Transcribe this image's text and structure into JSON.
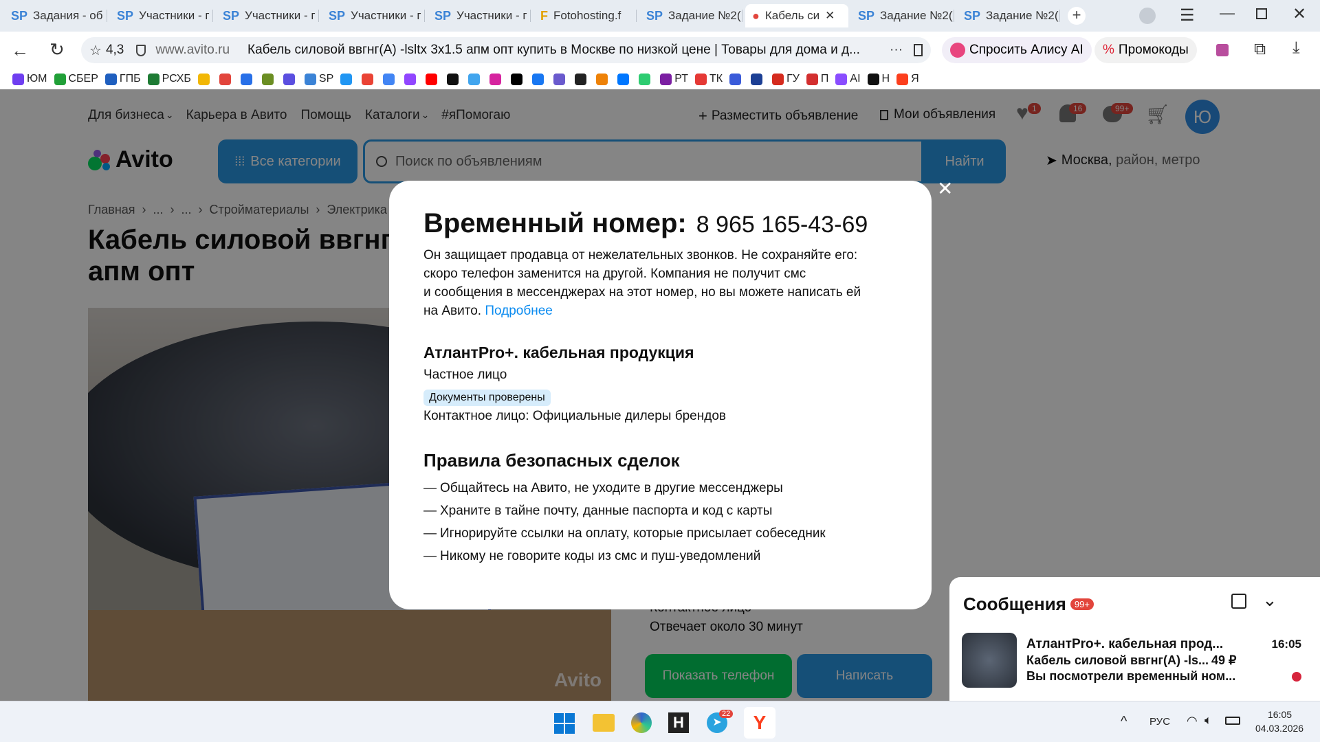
{
  "browser": {
    "tabs": [
      {
        "label": "Задания - об",
        "fav": "SP"
      },
      {
        "label": "Участники - г",
        "fav": "SP"
      },
      {
        "label": "Участники - г",
        "fav": "SP"
      },
      {
        "label": "Участники - г",
        "fav": "SP"
      },
      {
        "label": "Участники - г",
        "fav": "SP"
      },
      {
        "label": "Fotohosting.f",
        "fav": "F"
      },
      {
        "label": "Задание №2(",
        "fav": "SP"
      },
      {
        "label": "Кабель си",
        "fav": "●"
      },
      {
        "label": "Задание №2(",
        "fav": "SP"
      },
      {
        "label": "Задание №2(",
        "fav": "SP"
      }
    ],
    "rating": "4,3",
    "domain": "www.avito.ru",
    "page_title": "Кабель силовой ввгнг(А) -lsltx 3х1.5 апм опт купить в Москве по низкой цене | Товары для дома и д...",
    "alice_label": "Спросить Алису AI",
    "promo_label": "Промокоды",
    "bookmarks": [
      {
        "label": "ЮМ",
        "color": "#6f3ef0"
      },
      {
        "label": "СБЕР",
        "color": "#21a038"
      },
      {
        "label": "ГПБ",
        "color": "#1f5fbf"
      },
      {
        "label": "РСХБ",
        "color": "#1e7b34"
      },
      {
        "label": "",
        "color": "#f2b705"
      },
      {
        "label": "",
        "color": "#e2453c"
      },
      {
        "label": "",
        "color": "#2870e8"
      },
      {
        "label": "",
        "color": "#6b8e23"
      },
      {
        "label": "",
        "color": "#5b4fe0"
      },
      {
        "label": "SP",
        "color": "#3b83d6"
      },
      {
        "label": "",
        "color": "#2196f3"
      },
      {
        "label": "",
        "color": "#ea4335"
      },
      {
        "label": "",
        "color": "#4285f4"
      },
      {
        "label": "",
        "color": "#9146ff"
      },
      {
        "label": "",
        "color": "#ff0000"
      },
      {
        "label": "",
        "color": "#111111"
      },
      {
        "label": "",
        "color": "#41a5ee"
      },
      {
        "label": "",
        "color": "#d6249f"
      },
      {
        "label": "",
        "color": "#000000"
      },
      {
        "label": "",
        "color": "#1877f2"
      },
      {
        "label": "",
        "color": "#6a5acd"
      },
      {
        "label": "",
        "color": "#222222"
      },
      {
        "label": "",
        "color": "#ee8208"
      },
      {
        "label": "",
        "color": "#0077ff"
      },
      {
        "label": "",
        "color": "#2ecc71"
      },
      {
        "label": "РТ",
        "color": "#7b1fa2"
      },
      {
        "label": "ТК",
        "color": "#e53935"
      },
      {
        "label": "",
        "color": "#3a5bd9"
      },
      {
        "label": "",
        "color": "#1c3f94"
      },
      {
        "label": "ГУ",
        "color": "#d52b1e"
      },
      {
        "label": "П",
        "color": "#d32f2f"
      },
      {
        "label": "AI",
        "color": "#8a4dff"
      },
      {
        "label": "Н",
        "color": "#111111"
      },
      {
        "label": "Я",
        "color": "#fc3f1d"
      }
    ]
  },
  "avito": {
    "top_nav": [
      "Для бизнеса",
      "Карьера в Авито",
      "Помощь",
      "Каталоги",
      "#яПомогаю"
    ],
    "post_ad": "Разместить объявление",
    "my_ads": "Мои объявления",
    "badges": {
      "favorites": "1",
      "notifications": "16",
      "messages": "99+"
    },
    "avatar_letter": "Ю",
    "logo": "Avito",
    "all_categories": "Все категории",
    "search_placeholder": "Поиск по объявлениям",
    "search_button": "Найти",
    "location_city": "Москва,",
    "location_rest": " район, метро",
    "breadcrumbs": "Главная  ›  ...  ›  ...  ›  Стройматериалы  ›  Электрика  ›  Ка",
    "product_title_line1": "Кабель силовой ввгнг",
    "product_title_line2": "апм опт",
    "photo_watermark": "Avito",
    "seller_contact_partial": "Контактное лицо",
    "seller_response": "Отвечает около 30 минут",
    "show_phone": "Показать телефон",
    "write": "Написать"
  },
  "modal": {
    "title": "Временный номер:",
    "phone": "8 965 165-43-69",
    "desc_line1": "Он защищает продавца от нежелательных звонков. Не сохраняйте его:",
    "desc_line2": "скоро телефон заменится на другой. Компания не получит смс",
    "desc_line3": "и сообщения в мессенджерах на этот номер, но вы можете написать ей",
    "desc_line4": "на Авито. ",
    "more_link": "Подробнее",
    "seller_name": "АтлантPro+. кабельная продукция",
    "seller_type": "Частное лицо",
    "docs_badge": "Документы проверены",
    "contact_person": "Контактное лицо: Официальные дилеры брендов",
    "rules_title": "Правила безопасных сделок",
    "rules": [
      "Общайтесь на Авито, не уходите в другие мессенджеры",
      "Храните в тайне почту, данные паспорта и код с карты",
      "Игнорируйте ссылки на оплату, которые присылает собеседник",
      "Никому не говорите коды из смс и пуш-уведомлений"
    ]
  },
  "messages_panel": {
    "title": "Сообщения",
    "badge": "99+",
    "chat_name": "АтлантPro+. кабельная прод...",
    "chat_time": "16:05",
    "chat_item": "Кабель силовой ввгнг(А) -ls...",
    "chat_price": "49 ₽",
    "chat_preview": "Вы посмотрели временный ном..."
  },
  "taskbar": {
    "telegram_badge": "22",
    "lang": "РУС",
    "time": "16:05",
    "date": "04.03.2026"
  }
}
